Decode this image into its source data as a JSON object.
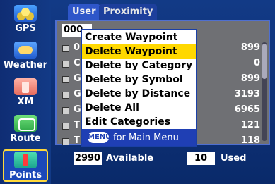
{
  "sidebar": {
    "items": [
      {
        "label": "GPS",
        "icon": "satellite-icon"
      },
      {
        "label": "Weather",
        "icon": "weather-icon"
      },
      {
        "label": "XM",
        "icon": "radio-icon"
      },
      {
        "label": "Route",
        "icon": "route-icon"
      },
      {
        "label": "Points",
        "icon": "waypoint-icon",
        "selected": true
      }
    ]
  },
  "tabs": [
    "User",
    "Proximity"
  ],
  "list": {
    "name_field": "000",
    "rows": [
      {
        "name": "0",
        "value": "899"
      },
      {
        "name": "C",
        "value": "0"
      },
      {
        "name": "G",
        "value": "899"
      },
      {
        "name": "G",
        "value": "3193"
      },
      {
        "name": "G",
        "value": "6965"
      },
      {
        "name": "T",
        "value": "121"
      },
      {
        "name": "T",
        "value": "118"
      }
    ]
  },
  "status": {
    "available_count": "2990",
    "available_label": "Available",
    "used_count": "10",
    "used_label": "Used"
  },
  "menu": {
    "items": [
      "Create Waypoint",
      "Delete Waypoint",
      "Delete by Category",
      "Delete by Symbol",
      "Delete by Distance",
      "Delete All",
      "Edit Categories"
    ],
    "highlight_index": 1,
    "footer_badge": "MENU",
    "footer_text": "for Main Menu"
  },
  "colors": {
    "accent": "#ffd800",
    "menu_footer": "#1f3fb4",
    "selection_outline": "#ffd83a"
  }
}
